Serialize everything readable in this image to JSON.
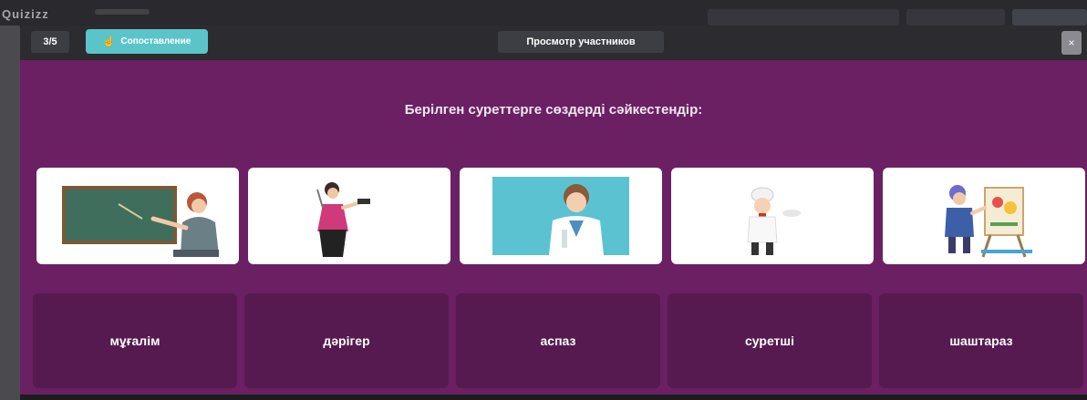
{
  "app": {
    "logo": "Quizizz"
  },
  "header": {
    "counter": "3/5",
    "question_type": "Сопоставление",
    "participants_button": "Просмотр участников",
    "close_label": "×"
  },
  "question": {
    "text": "Берілген суреттерге сөздерді сәйкестендір:"
  },
  "image_cards": [
    {
      "icon": "teacher-at-chalkboard-image"
    },
    {
      "icon": "hairdresser-image"
    },
    {
      "icon": "doctor-image"
    },
    {
      "icon": "chef-image"
    },
    {
      "icon": "painter-image"
    }
  ],
  "answers": [
    {
      "label": "мұғалім"
    },
    {
      "label": "дәрігер"
    },
    {
      "label": "аспаз"
    },
    {
      "label": "суретші"
    },
    {
      "label": "шаштараз"
    }
  ],
  "colors": {
    "modal_bg": "#6a2063",
    "answer_bg": "#561a51",
    "badge": "#5bc4c9",
    "header": "#2b2b30"
  }
}
